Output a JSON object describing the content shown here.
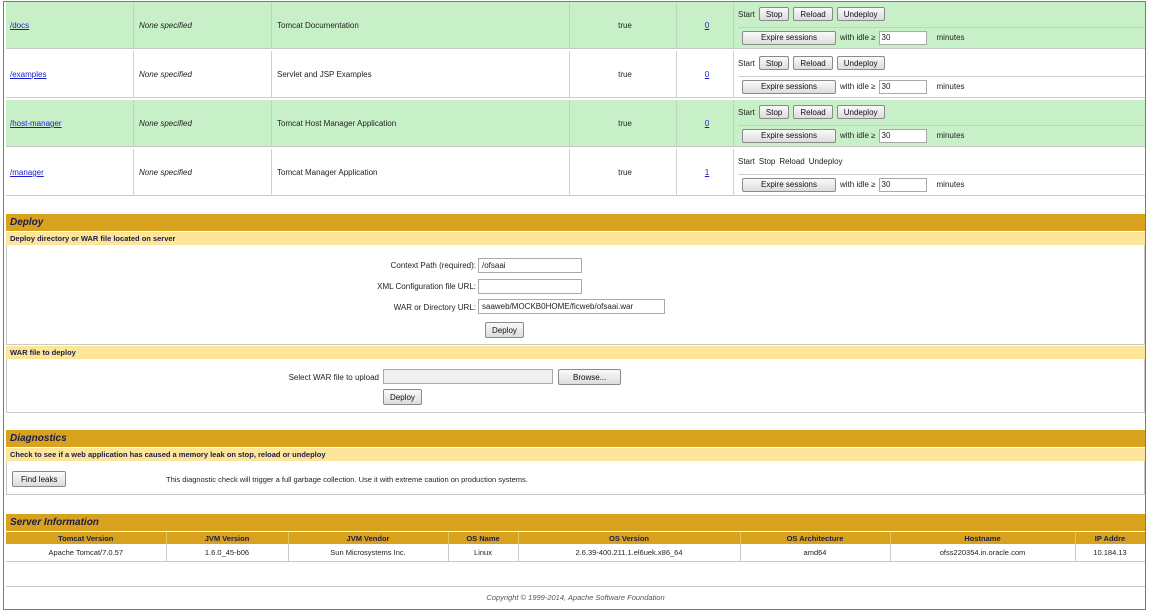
{
  "apps": [
    {
      "path": "/docs",
      "version": "None specified",
      "display_name": "Tomcat Documentation",
      "running": "true",
      "sessions": "0",
      "commands": [
        "Start",
        "Stop",
        "Reload",
        "Undeploy"
      ],
      "commands_enabled": true,
      "expire_label": "Expire sessions",
      "idle_label": "with idle ≥",
      "idle_value": "30",
      "minutes_label": "minutes",
      "row_style": "green"
    },
    {
      "path": "/examples",
      "version": "None specified",
      "display_name": "Servlet and JSP Examples",
      "running": "true",
      "sessions": "0",
      "commands": [
        "Start",
        "Stop",
        "Reload",
        "Undeploy"
      ],
      "commands_enabled": true,
      "expire_label": "Expire sessions",
      "idle_label": "with idle ≥",
      "idle_value": "30",
      "minutes_label": "minutes",
      "row_style": "white"
    },
    {
      "path": "/host-manager",
      "version": "None specified",
      "display_name": "Tomcat Host Manager Application",
      "running": "true",
      "sessions": "0",
      "commands": [
        "Start",
        "Stop",
        "Reload",
        "Undeploy"
      ],
      "commands_enabled": true,
      "expire_label": "Expire sessions",
      "idle_label": "with idle ≥",
      "idle_value": "30",
      "minutes_label": "minutes",
      "row_style": "green"
    },
    {
      "path": "/manager",
      "version": "None specified",
      "display_name": "Tomcat Manager Application",
      "running": "true",
      "sessions": "1",
      "commands": [
        "Start",
        "Stop",
        "Reload",
        "Undeploy"
      ],
      "commands_enabled": false,
      "expire_label": "Expire sessions",
      "idle_label": "with idle ≥",
      "idle_value": "30",
      "minutes_label": "minutes",
      "row_style": "white"
    }
  ],
  "deploy": {
    "title": "Deploy",
    "server_subtitle": "Deploy directory or WAR file located on server",
    "context_path_label": "Context Path (required):",
    "context_path_value": "/ofsaai",
    "xml_config_label": "XML Configuration file URL:",
    "xml_config_value": "",
    "war_dir_label": "WAR or Directory URL:",
    "war_dir_value": "saaweb/MOCKB0HOME/ficweb/ofsaai.war",
    "deploy_button": "Deploy",
    "war_upload_subtitle": "WAR file to deploy",
    "select_war_label": "Select WAR file to upload",
    "browse_button": "Browse...",
    "upload_deploy_button": "Deploy"
  },
  "diagnostics": {
    "title": "Diagnostics",
    "subtitle": "Check to see if a web application has caused a memory leak on stop, reload or undeploy",
    "find_leaks_button": "Find leaks",
    "description": "This diagnostic check will trigger a full garbage collection. Use it with extreme caution on production systems."
  },
  "server_info": {
    "title": "Server Information",
    "headers": [
      "Tomcat Version",
      "JVM Version",
      "JVM Vendor",
      "OS Name",
      "OS Version",
      "OS Architecture",
      "Hostname",
      "IP Addre"
    ],
    "values": [
      "Apache Tomcat/7.0.57",
      "1.6.0_45-b06",
      "Sun Microsystems Inc.",
      "Linux",
      "2.6.39-400.211.1.el6uek.x86_64",
      "amd64",
      "ofss220354.in.oracle.com",
      "10.184.13"
    ]
  },
  "footer": "Copyright © 1999-2014, Apache Software Foundation",
  "colors": {
    "accent": "#d8a21e",
    "subheader": "#fde69a",
    "row_green": "#c8f0c8",
    "link": "#1a1ad0"
  }
}
